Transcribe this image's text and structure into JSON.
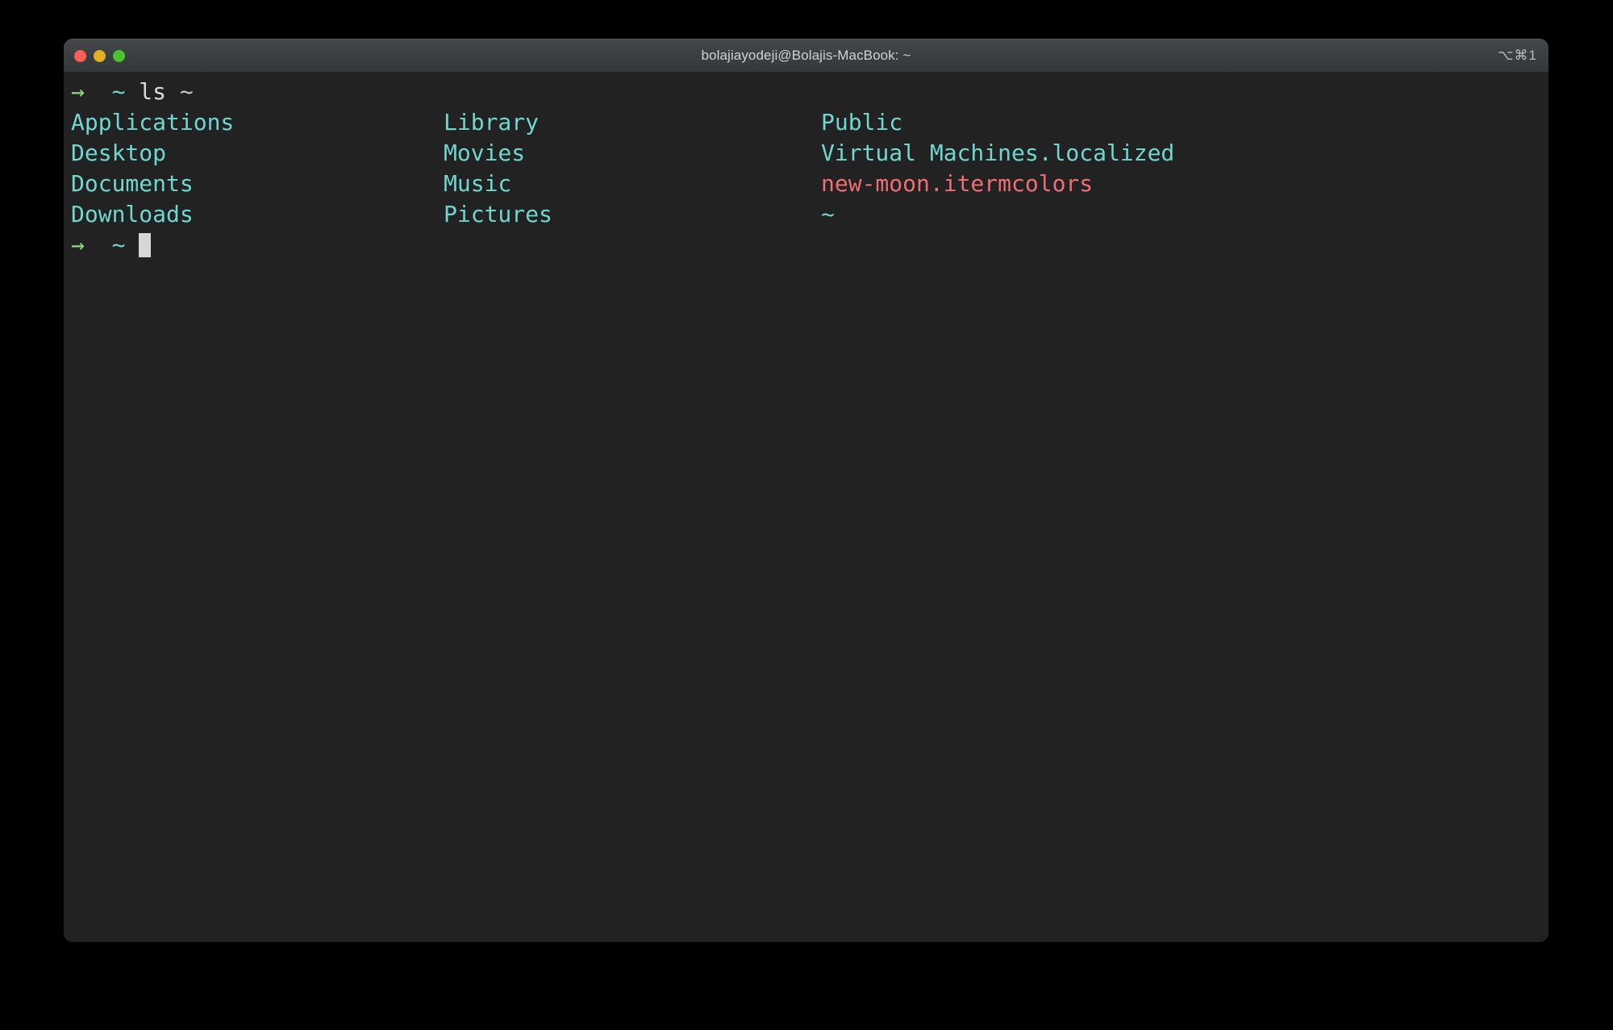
{
  "window": {
    "title": "bolajiayodeji@Bolajis-MacBook: ~",
    "shortcut_badge": "⌥⌘1",
    "traffic_lights": {
      "close": "close-button",
      "minimize": "minimize-button",
      "zoom": "zoom-button"
    }
  },
  "colors": {
    "background": "#222222",
    "titlebar": "#3d4043",
    "cyan": "#70d6d0",
    "red": "#ee6e73",
    "green": "#8adb81",
    "white": "#d9d9d9",
    "cursor": "#d6d6d6",
    "light_close": "#f95e57",
    "light_minimize": "#e3b023",
    "light_zoom": "#4bc42c"
  },
  "terminal": {
    "prompt_line": {
      "arrow": "→",
      "path": "~",
      "command": "ls",
      "argument": "~"
    },
    "listing": {
      "column1": [
        {
          "name": "Applications",
          "kind": "directory"
        },
        {
          "name": "Desktop",
          "kind": "directory"
        },
        {
          "name": "Documents",
          "kind": "directory"
        },
        {
          "name": "Downloads",
          "kind": "directory"
        }
      ],
      "column2": [
        {
          "name": "Library",
          "kind": "directory"
        },
        {
          "name": "Movies",
          "kind": "directory"
        },
        {
          "name": "Music",
          "kind": "directory"
        },
        {
          "name": "Pictures",
          "kind": "directory"
        }
      ],
      "column3": [
        {
          "name": "Public",
          "kind": "directory"
        },
        {
          "name": "Virtual Machines.localized",
          "kind": "directory"
        },
        {
          "name": "new-moon.itermcolors",
          "kind": "file"
        },
        {
          "name": "~",
          "kind": "directory"
        }
      ]
    },
    "input_line": {
      "arrow": "→",
      "path": "~",
      "typed_text": ""
    }
  }
}
